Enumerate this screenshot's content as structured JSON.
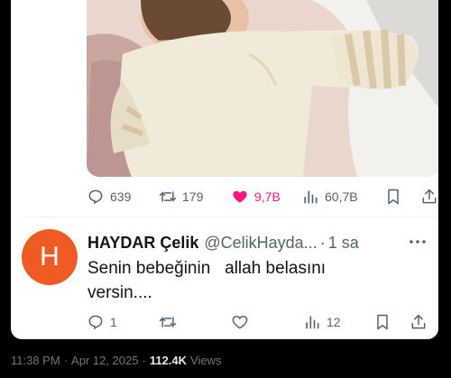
{
  "colors": {
    "like_pink": "#f91880",
    "muted": "#536471",
    "avatar_bg": "#ef5b22"
  },
  "original_tweet": {
    "media": {
      "description": "photo of a baby hugging a man"
    },
    "actions": {
      "replies": {
        "icon": "reply-icon",
        "count": "639"
      },
      "retweets": {
        "icon": "retweet-icon",
        "count": "179"
      },
      "likes": {
        "icon": "heart-filled-icon",
        "count": "9,7B"
      },
      "views": {
        "icon": "views-icon",
        "count": "60,7B"
      },
      "bookmark": {
        "icon": "bookmark-icon"
      },
      "share": {
        "icon": "share-icon"
      }
    }
  },
  "reply": {
    "avatar_letter": "H",
    "name": "HAYDAR Çelik",
    "handle": "@CelikHayda...",
    "dot": "·",
    "time": "1 sa",
    "text": "Senin bebeğinin   allah belasını\nversin....",
    "actions": {
      "replies": {
        "icon": "reply-icon",
        "count": "1"
      },
      "retweets": {
        "icon": "retweet-icon",
        "count": ""
      },
      "likes": {
        "icon": "heart-icon",
        "count": ""
      },
      "views": {
        "icon": "views-icon",
        "count": "12"
      },
      "bookmark": {
        "icon": "bookmark-icon"
      },
      "share": {
        "icon": "share-icon"
      }
    }
  },
  "footer": {
    "time": "11:38 PM",
    "sep": "·",
    "date": "Apr 12, 2025",
    "sep2": "·",
    "views_count": "112.4K",
    "views_label": "Views"
  }
}
